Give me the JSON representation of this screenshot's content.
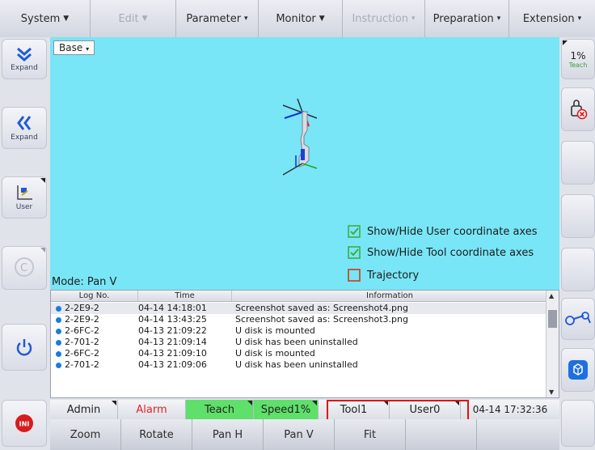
{
  "menu": [
    {
      "label": "System",
      "arrow": "▼",
      "disabled": false
    },
    {
      "label": "Edit",
      "arrow": "▼",
      "disabled": true
    },
    {
      "label": "Parameter",
      "arrow": "▾",
      "disabled": false
    },
    {
      "label": "Monitor",
      "arrow": "▼",
      "disabled": false
    },
    {
      "label": "Instruction",
      "arrow": "▾",
      "disabled": true
    },
    {
      "label": "Preparation",
      "arrow": "▾",
      "disabled": false
    },
    {
      "label": "Extension",
      "arrow": "▾",
      "disabled": false
    }
  ],
  "left": {
    "expand1": "Expand",
    "expand2": "Expand",
    "user": "User",
    "init_badge": "INI"
  },
  "viewport": {
    "coord_select": "Base",
    "mode": "Mode: Pan V",
    "show_user_axes": "Show/Hide User coordinate axes",
    "show_tool_axes": "Show/Hide Tool coordinate axes",
    "trajectory": "Trajectory",
    "user_axes_checked": true,
    "tool_axes_checked": true,
    "trajectory_checked": false
  },
  "log": {
    "headers": [
      "Log No.",
      "Time",
      "Information"
    ],
    "rows": [
      {
        "no": "2-2E9-2",
        "time": "04-14 14:18:01",
        "info": "Screenshot saved as: Screenshot4.png"
      },
      {
        "no": "2-2E9-2",
        "time": "04-14 13:43:25",
        "info": "Screenshot saved as: Screenshot3.png"
      },
      {
        "no": "2-6FC-2",
        "time": "04-13 21:09:22",
        "info": "U disk is mounted"
      },
      {
        "no": "2-701-2",
        "time": "04-13 21:09:14",
        "info": "U disk has been uninstalled"
      },
      {
        "no": "2-6FC-2",
        "time": "04-13 21:09:10",
        "info": "U disk is mounted"
      },
      {
        "no": "2-701-2",
        "time": "04-13 21:09:06",
        "info": "U disk has been uninstalled"
      }
    ]
  },
  "status": {
    "user": "Admin",
    "alarm": "Alarm",
    "mode": "Teach",
    "speed": "Speed1%",
    "tool": "Tool1",
    "usercoord": "User0",
    "datetime": "04-14 17:32:36"
  },
  "bottom": [
    "Zoom",
    "Rotate",
    "Pan H",
    "Pan V",
    "Fit",
    "",
    "",
    ""
  ],
  "right": {
    "speed_pct": "1%",
    "speed_mode": "Teach"
  },
  "colors": {
    "viewport_bg": "#78e6f6",
    "teach_green": "#5fe06a",
    "alarm_red": "#e02424",
    "highlight_frame": "#e21010"
  }
}
